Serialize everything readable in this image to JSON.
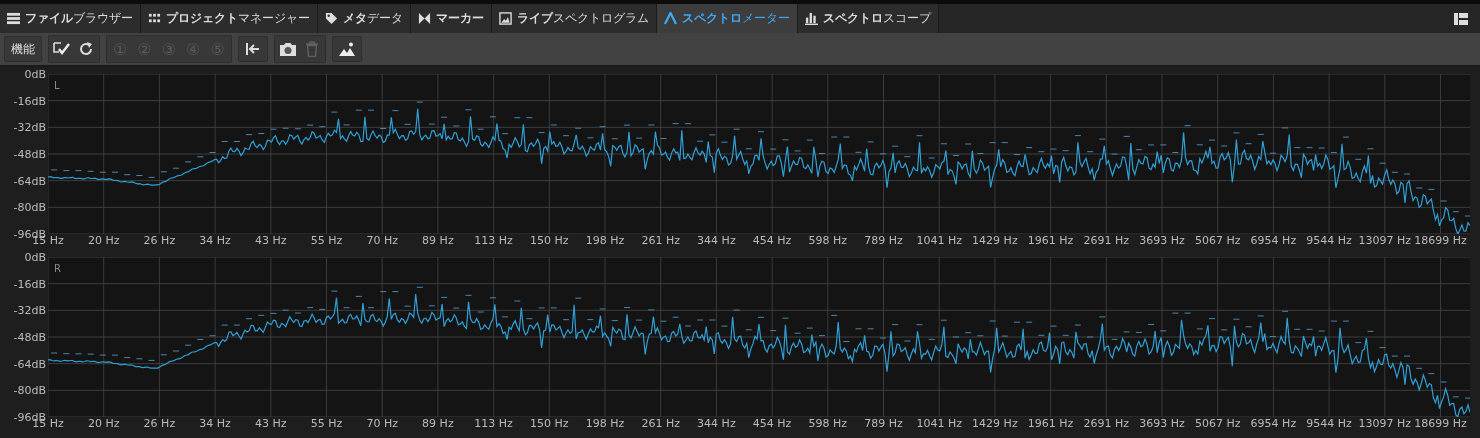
{
  "tabs": [
    {
      "label": "**ファイル**ブラウザー",
      "selected": false,
      "bold": false
    },
    {
      "label": "**プロジェクト**マネージャー",
      "selected": false,
      "bold": false
    },
    {
      "label": "**メタ**データ",
      "selected": false,
      "bold": false
    },
    {
      "label": "マーカー",
      "selected": false,
      "bold": true
    },
    {
      "label": "**ライブ**スペクトログラム",
      "selected": false,
      "bold": false
    },
    {
      "label": "**スペクトロ**メーター",
      "selected": true,
      "bold": false
    },
    {
      "label": "**スペクトロ**スコープ",
      "selected": false,
      "bold": false
    }
  ],
  "toolbar": {
    "function_button": "機能",
    "presets": [
      {
        "label": "①",
        "disabled": true
      },
      {
        "label": "②",
        "disabled": true
      },
      {
        "label": "③",
        "disabled": true
      },
      {
        "label": "④",
        "disabled": true
      },
      {
        "label": "⑤",
        "disabled": true
      }
    ],
    "delete_disabled": true
  },
  "channels": [
    {
      "label": "L",
      "y_labels": [
        "0dB",
        "-16dB",
        "-32dB",
        "-48dB",
        "-64dB",
        "-80dB",
        "-96dB"
      ],
      "x_labels": [
        "15 Hz",
        "20 Hz",
        "26 Hz",
        "34 Hz",
        "43 Hz",
        "55 Hz",
        "70 Hz",
        "89 Hz",
        "113 Hz",
        "150 Hz",
        "198 Hz",
        "261 Hz",
        "344 Hz",
        "454 Hz",
        "598 Hz",
        "789 Hz",
        "1041 Hz",
        "1429 Hz",
        "1961 Hz",
        "2691 Hz",
        "3693 Hz",
        "5067 Hz",
        "6954 Hz",
        "9544 Hz",
        "13097 Hz",
        "18699 Hz"
      ]
    },
    {
      "label": "R",
      "y_labels": [
        "0dB",
        "-16dB",
        "-32dB",
        "-48dB",
        "-64dB",
        "-80dB",
        "-96dB"
      ],
      "x_labels": [
        "15 Hz",
        "20 Hz",
        "26 Hz",
        "34 Hz",
        "43 Hz",
        "55 Hz",
        "70 Hz",
        "89 Hz",
        "113 Hz",
        "150 Hz",
        "198 Hz",
        "261 Hz",
        "344 Hz",
        "454 Hz",
        "598 Hz",
        "789 Hz",
        "1041 Hz",
        "1429 Hz",
        "1961 Hz",
        "2691 Hz",
        "3693 Hz",
        "5067 Hz",
        "6954 Hz",
        "9544 Hz",
        "13097 Hz",
        "18699 Hz"
      ]
    }
  ]
}
